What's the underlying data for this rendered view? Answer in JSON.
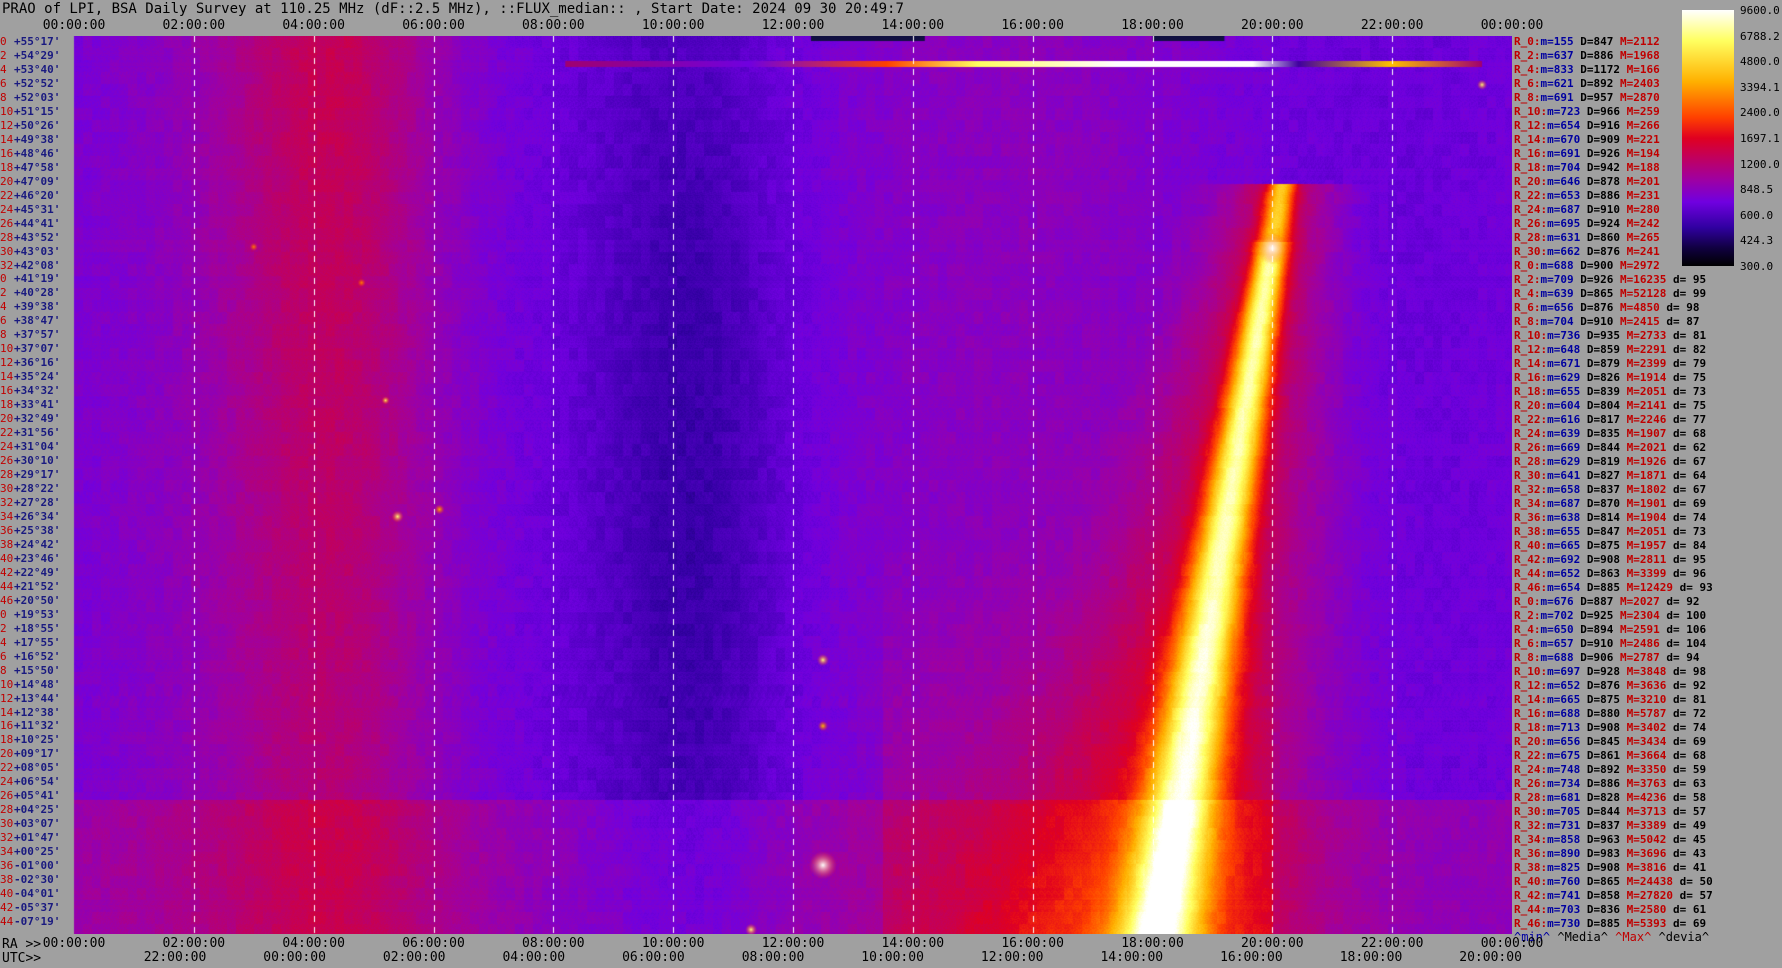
{
  "title": "PRAO of LPI, BSA Daily Survey at 110.25 MHz (dF::2.5 MHz), ::FLUX_median:: , Start Date: 2024 09 30 20:49:7",
  "top_ticks": [
    "00:00:00",
    "02:00:00",
    "04:00:00",
    "06:00:00",
    "08:00:00",
    "10:00:00",
    "12:00:00",
    "14:00:00",
    "16:00:00",
    "18:00:00",
    "20:00:00",
    "22:00:00",
    "00:00:00"
  ],
  "ra_label": "RA >>",
  "ra_ticks": [
    "00:00:00",
    "02:00:00",
    "04:00:00",
    "06:00:00",
    "08:00:00",
    "10:00:00",
    "12:00:00",
    "14:00:00",
    "16:00:00",
    "18:00:00",
    "20:00:00",
    "22:00:00",
    "00:00:00"
  ],
  "utc_label": "UTC>>",
  "utc_ticks": [
    "22:00:00",
    "00:00:00",
    "02:00:00",
    "04:00:00",
    "06:00:00",
    "08:00:00",
    "10:00:00",
    "12:00:00",
    "14:00:00",
    "16:00:00",
    "18:00:00",
    "20:00:00"
  ],
  "colorbar_labels": [
    "9600.0",
    "6788.2",
    "4800.0",
    "3394.1",
    "2400.0",
    "1697.1",
    "1200.0",
    "848.5",
    "600.0",
    "424.3",
    "300.0"
  ],
  "colors": {
    "low": "#000000",
    "mid": "#7000e0",
    "high": "#ff4000",
    "peak": "#ffffff"
  },
  "declinations": [
    {
      "idx": "0",
      "lab": "+55°17'"
    },
    {
      "idx": "2",
      "lab": "+54°29'"
    },
    {
      "idx": "4",
      "lab": "+53°40'"
    },
    {
      "idx": "6",
      "lab": "+52°52'"
    },
    {
      "idx": "8",
      "lab": "+52°03'"
    },
    {
      "idx": "10",
      "lab": "+51°15'"
    },
    {
      "idx": "12",
      "lab": "+50°26'"
    },
    {
      "idx": "14",
      "lab": "+49°38'"
    },
    {
      "idx": "16",
      "lab": "+48°46'"
    },
    {
      "idx": "18",
      "lab": "+47°58'"
    },
    {
      "idx": "20",
      "lab": "+47°09'"
    },
    {
      "idx": "22",
      "lab": "+46°20'"
    },
    {
      "idx": "24",
      "lab": "+45°31'"
    },
    {
      "idx": "26",
      "lab": "+44°41'"
    },
    {
      "idx": "28",
      "lab": "+43°52'"
    },
    {
      "idx": "30",
      "lab": "+43°03'"
    },
    {
      "idx": "32",
      "lab": "+42°08'"
    },
    {
      "idx": "0",
      "lab": "+41°19'"
    },
    {
      "idx": "2",
      "lab": "+40°28'"
    },
    {
      "idx": "4",
      "lab": "+39°38'"
    },
    {
      "idx": "6",
      "lab": "+38°47'"
    },
    {
      "idx": "8",
      "lab": "+37°57'"
    },
    {
      "idx": "10",
      "lab": "+37°07'"
    },
    {
      "idx": "12",
      "lab": "+36°16'"
    },
    {
      "idx": "14",
      "lab": "+35°24'"
    },
    {
      "idx": "16",
      "lab": "+34°32'"
    },
    {
      "idx": "18",
      "lab": "+33°41'"
    },
    {
      "idx": "20",
      "lab": "+32°49'"
    },
    {
      "idx": "22",
      "lab": "+31°56'"
    },
    {
      "idx": "24",
      "lab": "+31°04'"
    },
    {
      "idx": "26",
      "lab": "+30°10'"
    },
    {
      "idx": "28",
      "lab": "+29°17'"
    },
    {
      "idx": "30",
      "lab": "+28°22'"
    },
    {
      "idx": "32",
      "lab": "+27°28'"
    },
    {
      "idx": "34",
      "lab": "+26°34'"
    },
    {
      "idx": "36",
      "lab": "+25°38'"
    },
    {
      "idx": "38",
      "lab": "+24°42'"
    },
    {
      "idx": "40",
      "lab": "+23°46'"
    },
    {
      "idx": "42",
      "lab": "+22°49'"
    },
    {
      "idx": "44",
      "lab": "+21°52'"
    },
    {
      "idx": "46",
      "lab": "+20°50'"
    },
    {
      "idx": "0",
      "lab": "+19°53'"
    },
    {
      "idx": "2",
      "lab": "+18°55'"
    },
    {
      "idx": "4",
      "lab": "+17°55'"
    },
    {
      "idx": "6",
      "lab": "+16°52'"
    },
    {
      "idx": "8",
      "lab": "+15°50'"
    },
    {
      "idx": "10",
      "lab": "+14°48'"
    },
    {
      "idx": "12",
      "lab": "+13°44'"
    },
    {
      "idx": "14",
      "lab": "+12°38'"
    },
    {
      "idx": "16",
      "lab": "+11°32'"
    },
    {
      "idx": "18",
      "lab": "+10°25'"
    },
    {
      "idx": "20",
      "lab": "+09°17'"
    },
    {
      "idx": "22",
      "lab": "+08°05'"
    },
    {
      "idx": "24",
      "lab": "+06°54'"
    },
    {
      "idx": "26",
      "lab": "+05°41'"
    },
    {
      "idx": "28",
      "lab": "+04°25'"
    },
    {
      "idx": "30",
      "lab": "+03°07'"
    },
    {
      "idx": "32",
      "lab": "+01°47'"
    },
    {
      "idx": "34",
      "lab": "+00°25'"
    },
    {
      "idx": "36",
      "lab": "-01°00'"
    },
    {
      "idx": "38",
      "lab": "-02°30'"
    },
    {
      "idx": "40",
      "lab": "-04°01'"
    },
    {
      "idx": "42",
      "lab": "-05°37'"
    },
    {
      "idx": "44",
      "lab": "-07°19'"
    }
  ],
  "stats": [
    {
      "r": "R_0:",
      "m": "155",
      "D": "847",
      "M": "2112",
      "d": ""
    },
    {
      "r": "R_2:",
      "m": "637",
      "D": "886",
      "M": "1968",
      "d": ""
    },
    {
      "r": "R_4:",
      "m": "833",
      "D": "1172",
      "M": "166",
      "d": ""
    },
    {
      "r": "R_6:",
      "m": "621",
      "D": "892",
      "M": "2403",
      "d": ""
    },
    {
      "r": "R_8:",
      "m": "691",
      "D": "957",
      "M": "2870",
      "d": ""
    },
    {
      "r": "R_10:",
      "m": "723",
      "D": "966",
      "M": "259",
      "d": ""
    },
    {
      "r": "R_12:",
      "m": "654",
      "D": "916",
      "M": "266",
      "d": ""
    },
    {
      "r": "R_14:",
      "m": "670",
      "D": "909",
      "M": "221",
      "d": ""
    },
    {
      "r": "R_16:",
      "m": "691",
      "D": "926",
      "M": "194",
      "d": ""
    },
    {
      "r": "R_18:",
      "m": "704",
      "D": "942",
      "M": "188",
      "d": ""
    },
    {
      "r": "R_20:",
      "m": "646",
      "D": "878",
      "M": "201",
      "d": ""
    },
    {
      "r": "R_22:",
      "m": "653",
      "D": "886",
      "M": "231",
      "d": ""
    },
    {
      "r": "R_24:",
      "m": "687",
      "D": "910",
      "M": "280",
      "d": ""
    },
    {
      "r": "R_26:",
      "m": "695",
      "D": "924",
      "M": "242",
      "d": ""
    },
    {
      "r": "R_28:",
      "m": "631",
      "D": "860",
      "M": "265",
      "d": ""
    },
    {
      "r": "R_30:",
      "m": "662",
      "D": "876",
      "M": "241",
      "d": ""
    },
    {
      "r": "R_0:",
      "m": "688",
      "D": "900",
      "M": "2972",
      "d": ""
    },
    {
      "r": "R_2:",
      "m": "709",
      "D": "926",
      "M": "16235",
      "d": "95"
    },
    {
      "r": "R_4:",
      "m": "639",
      "D": "865",
      "M": "52128",
      "d": "99"
    },
    {
      "r": "R_6:",
      "m": "656",
      "D": "876",
      "M": "4850",
      "d": "98"
    },
    {
      "r": "R_8:",
      "m": "704",
      "D": "910",
      "M": "2415",
      "d": "87"
    },
    {
      "r": "R_10:",
      "m": "736",
      "D": "935",
      "M": "2733",
      "d": "81"
    },
    {
      "r": "R_12:",
      "m": "648",
      "D": "859",
      "M": "2291",
      "d": "82"
    },
    {
      "r": "R_14:",
      "m": "671",
      "D": "879",
      "M": "2399",
      "d": "79"
    },
    {
      "r": "R_16:",
      "m": "629",
      "D": "826",
      "M": "1914",
      "d": "75"
    },
    {
      "r": "R_18:",
      "m": "655",
      "D": "839",
      "M": "2051",
      "d": "73"
    },
    {
      "r": "R_20:",
      "m": "604",
      "D": "804",
      "M": "2141",
      "d": "75"
    },
    {
      "r": "R_22:",
      "m": "616",
      "D": "817",
      "M": "2246",
      "d": "77"
    },
    {
      "r": "R_24:",
      "m": "639",
      "D": "835",
      "M": "1907",
      "d": "68"
    },
    {
      "r": "R_26:",
      "m": "669",
      "D": "844",
      "M": "2021",
      "d": "62"
    },
    {
      "r": "R_28:",
      "m": "629",
      "D": "819",
      "M": "1926",
      "d": "67"
    },
    {
      "r": "R_30:",
      "m": "641",
      "D": "827",
      "M": "1871",
      "d": "64"
    },
    {
      "r": "R_32:",
      "m": "658",
      "D": "837",
      "M": "1802",
      "d": "67"
    },
    {
      "r": "R_34:",
      "m": "687",
      "D": "870",
      "M": "1901",
      "d": "69"
    },
    {
      "r": "R_36:",
      "m": "638",
      "D": "814",
      "M": "1904",
      "d": "74"
    },
    {
      "r": "R_38:",
      "m": "655",
      "D": "847",
      "M": "2051",
      "d": "73"
    },
    {
      "r": "R_40:",
      "m": "665",
      "D": "875",
      "M": "1957",
      "d": "84"
    },
    {
      "r": "R_42:",
      "m": "692",
      "D": "908",
      "M": "2811",
      "d": "95"
    },
    {
      "r": "R_44:",
      "m": "652",
      "D": "863",
      "M": "3399",
      "d": "96"
    },
    {
      "r": "R_46:",
      "m": "654",
      "D": "885",
      "M": "12429",
      "d": "93"
    },
    {
      "r": "R_0:",
      "m": "676",
      "D": "887",
      "M": "2027",
      "d": "92"
    },
    {
      "r": "R_2:",
      "m": "702",
      "D": "925",
      "M": "2304",
      "d": "100"
    },
    {
      "r": "R_4:",
      "m": "650",
      "D": "894",
      "M": "2591",
      "d": "106"
    },
    {
      "r": "R_6:",
      "m": "657",
      "D": "910",
      "M": "2486",
      "d": "104"
    },
    {
      "r": "R_8:",
      "m": "688",
      "D": "906",
      "M": "2787",
      "d": "94"
    },
    {
      "r": "R_10:",
      "m": "697",
      "D": "928",
      "M": "3848",
      "d": "98"
    },
    {
      "r": "R_12:",
      "m": "652",
      "D": "876",
      "M": "3636",
      "d": "92"
    },
    {
      "r": "R_14:",
      "m": "665",
      "D": "875",
      "M": "3210",
      "d": "81"
    },
    {
      "r": "R_16:",
      "m": "688",
      "D": "880",
      "M": "5787",
      "d": "72"
    },
    {
      "r": "R_18:",
      "m": "713",
      "D": "908",
      "M": "3402",
      "d": "74"
    },
    {
      "r": "R_20:",
      "m": "656",
      "D": "845",
      "M": "3434",
      "d": "69"
    },
    {
      "r": "R_22:",
      "m": "675",
      "D": "861",
      "M": "3664",
      "d": "68"
    },
    {
      "r": "R_24:",
      "m": "748",
      "D": "892",
      "M": "3350",
      "d": "59"
    },
    {
      "r": "R_26:",
      "m": "734",
      "D": "886",
      "M": "3763",
      "d": "63"
    },
    {
      "r": "R_28:",
      "m": "681",
      "D": "828",
      "M": "4236",
      "d": "58"
    },
    {
      "r": "R_30:",
      "m": "705",
      "D": "844",
      "M": "3713",
      "d": "57"
    },
    {
      "r": "R_32:",
      "m": "731",
      "D": "837",
      "M": "3389",
      "d": "49"
    },
    {
      "r": "R_34:",
      "m": "858",
      "D": "963",
      "M": "5042",
      "d": "45"
    },
    {
      "r": "R_36:",
      "m": "890",
      "D": "983",
      "M": "3696",
      "d": "43"
    },
    {
      "r": "R_38:",
      "m": "825",
      "D": "908",
      "M": "3816",
      "d": "41"
    },
    {
      "r": "R_40:",
      "m": "760",
      "D": "865",
      "M": "24438",
      "d": "50"
    },
    {
      "r": "R_42:",
      "m": "741",
      "D": "858",
      "M": "27820",
      "d": "57"
    },
    {
      "r": "R_44:",
      "m": "703",
      "D": "836",
      "M": "2580",
      "d": "61"
    },
    {
      "r": "R_46:",
      "m": "730",
      "D": "885",
      "M": "5393",
      "d": "69"
    }
  ],
  "legend": {
    "min": "^min^",
    "median": "^Media^",
    "max": "^Max^",
    "devia": "^devia^"
  },
  "chart_data": {
    "type": "heatmap",
    "title": "PRAO of LPI, BSA Daily Survey at 110.25 MHz (dF::2.5 MHz), ::FLUX_median:: , Start Date: 2024 09 30 20:49:7",
    "x_ra_hours": [
      0,
      24
    ],
    "y_dec_deg": [
      55.28,
      -7.32
    ],
    "colorbar_range": [
      300.0,
      9600.0
    ],
    "colorbar_scale": "log",
    "features": [
      {
        "label": "galactic plane band",
        "ra_start_h": 20.0,
        "dec_start": 41,
        "ra_end_h": 18.1,
        "dec_end": -7
      },
      {
        "label": "bright source",
        "ra_h": 20.0,
        "dec": 40.5
      },
      {
        "label": "bright source",
        "ra_h": 12.5,
        "dec": -2.5
      },
      {
        "label": "bright source",
        "ra_h": 5.4,
        "dec": 21.8
      }
    ]
  }
}
